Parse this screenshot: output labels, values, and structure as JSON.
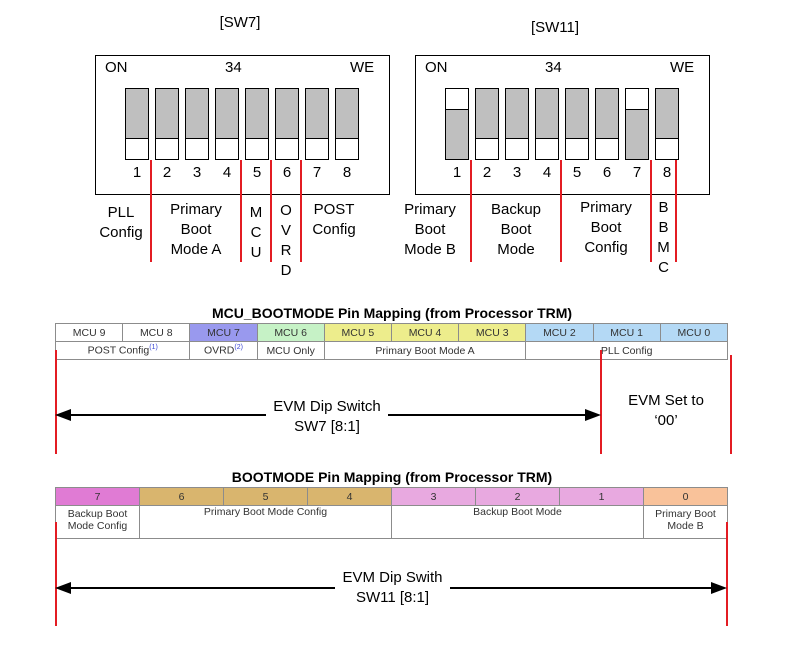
{
  "sw7": {
    "title": "[SW7]",
    "label_on": "ON",
    "label_mid": "34",
    "label_we": "WE",
    "switches": [
      {
        "num": "1",
        "on": false
      },
      {
        "num": "2",
        "on": false
      },
      {
        "num": "3",
        "on": false
      },
      {
        "num": "4",
        "on": false
      },
      {
        "num": "5",
        "on": false
      },
      {
        "num": "6",
        "on": false
      },
      {
        "num": "7",
        "on": false
      },
      {
        "num": "8",
        "on": false
      }
    ],
    "groups": [
      {
        "lines": [
          "PLL",
          "Config"
        ]
      },
      {
        "lines": [
          "Primary",
          "Boot",
          "Mode A"
        ]
      },
      {
        "lines": [
          "M",
          "C",
          "U"
        ]
      },
      {
        "lines": [
          "O",
          "V",
          "R",
          "D"
        ]
      },
      {
        "lines": [
          "POST",
          "Config"
        ]
      }
    ]
  },
  "sw11": {
    "title": "[SW11]",
    "label_on": "ON",
    "label_mid": "34",
    "label_we": "WE",
    "switches": [
      {
        "num": "1",
        "on": true
      },
      {
        "num": "2",
        "on": false
      },
      {
        "num": "3",
        "on": false
      },
      {
        "num": "4",
        "on": false
      },
      {
        "num": "5",
        "on": false
      },
      {
        "num": "6",
        "on": false
      },
      {
        "num": "7",
        "on": true
      },
      {
        "num": "8",
        "on": false
      }
    ],
    "groups": [
      {
        "lines": [
          "Primary",
          "Boot",
          "Mode B"
        ]
      },
      {
        "lines": [
          "Backup",
          "Boot",
          "Mode"
        ]
      },
      {
        "lines": [
          "Primary",
          "Boot",
          "Config"
        ]
      },
      {
        "lines": [
          "B",
          "B",
          "M",
          "C"
        ]
      }
    ]
  },
  "mcu_table": {
    "title": "MCU_BOOTMODE Pin Mapping (from Processor TRM)",
    "pins": [
      {
        "label": "MCU 9",
        "color": "#ffffff"
      },
      {
        "label": "MCU 8",
        "color": "#ffffff"
      },
      {
        "label": "MCU 7",
        "color": "#9999ee"
      },
      {
        "label": "MCU 6",
        "color": "#c6f2c6"
      },
      {
        "label": "MCU 5",
        "color": "#eded8c"
      },
      {
        "label": "MCU 4",
        "color": "#eded8c"
      },
      {
        "label": "MCU 3",
        "color": "#eded8c"
      },
      {
        "label": "MCU 2",
        "color": "#b4d9f5"
      },
      {
        "label": "MCU 1",
        "color": "#b4d9f5"
      },
      {
        "label": "MCU 0",
        "color": "#b4d9f5"
      }
    ],
    "functions": [
      {
        "label": "POST Config",
        "note": "(1)",
        "span": 2
      },
      {
        "label": "OVRD",
        "note": "(2)",
        "span": 1
      },
      {
        "label": "MCU Only",
        "note": "",
        "span": 1
      },
      {
        "label": "Primary Boot Mode A",
        "note": "",
        "span": 3
      },
      {
        "label": "PLL Config",
        "note": "",
        "span": 3
      }
    ],
    "arrow_text_line1": "EVM Dip Switch",
    "arrow_text_line2": "SW7 [8:1]",
    "side_text_line1": "EVM Set to",
    "side_text_line2": "‘00’"
  },
  "boot_table": {
    "title": "BOOTMODE Pin Mapping (from Processor TRM)",
    "pins": [
      {
        "label": "7",
        "color": "#e07bd4"
      },
      {
        "label": "6",
        "color": "#d9b56e"
      },
      {
        "label": "5",
        "color": "#d9b56e"
      },
      {
        "label": "4",
        "color": "#d9b56e"
      },
      {
        "label": "3",
        "color": "#e8a9e0"
      },
      {
        "label": "2",
        "color": "#e8a9e0"
      },
      {
        "label": "1",
        "color": "#e8a9e0"
      },
      {
        "label": "0",
        "color": "#f9c29a"
      }
    ],
    "functions": [
      {
        "label": "Backup Boot Mode Config",
        "span": 1
      },
      {
        "label": "Primary Boot Mode Config",
        "span": 3
      },
      {
        "label": "Backup Boot Mode",
        "span": 3
      },
      {
        "label": "Primary Boot Mode B",
        "span": 1
      }
    ],
    "arrow_text_line1": "EVM Dip Swith",
    "arrow_text_line2": "SW11 [8:1]"
  }
}
